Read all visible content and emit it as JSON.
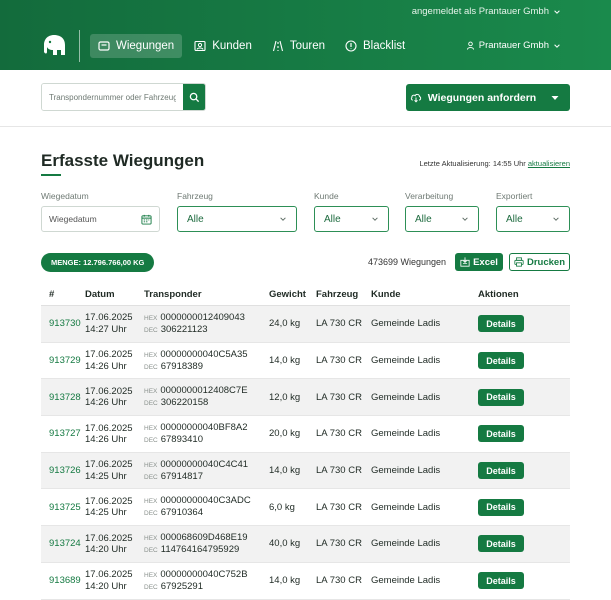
{
  "header": {
    "logged_in_as": "angemeldet als Prantauer Gmbh",
    "user": "Prantauer Gmbh",
    "nav": [
      {
        "label": "Wiegungen",
        "icon": "scale-icon",
        "active": true
      },
      {
        "label": "Kunden",
        "icon": "contact-card-icon",
        "active": false
      },
      {
        "label": "Touren",
        "icon": "road-icon",
        "active": false
      },
      {
        "label": "Blacklist",
        "icon": "block-icon",
        "active": false
      }
    ]
  },
  "toolbar": {
    "search_placeholder": "Transpondernummer oder Fahrzeug s",
    "request_label": "Wiegungen anfordern"
  },
  "main": {
    "title": "Erfasste Wiegungen",
    "last_update_prefix": "Letzte Aktualisierung: 14:55 Uhr",
    "refresh_link": "aktualisieren"
  },
  "filters": {
    "date_label": "Wiegedatum",
    "date_placeholder": "Wiegedatum",
    "vehicle_label": "Fahrzeug",
    "vehicle_value": "Alle",
    "customer_label": "Kunde",
    "customer_value": "Alle",
    "processing_label": "Verarbeitung",
    "processing_value": "Alle",
    "exported_label": "Exportiert",
    "exported_value": "Alle"
  },
  "summary": {
    "menge": "MENGE: 12.796.766,00 KG",
    "count": "473699 Wiegungen",
    "excel_label": "Excel",
    "print_label": "Drucken"
  },
  "table": {
    "headers": [
      "#",
      "Datum",
      "Transponder",
      "Gewicht",
      "Fahrzeug",
      "Kunde",
      "Aktionen"
    ],
    "hex_tag": "HEX",
    "dec_tag": "DEC",
    "details_label": "Details",
    "rows": [
      {
        "id": "913730",
        "date": "17.06.2025",
        "time": "14:27 Uhr",
        "hex": "0000000012409043",
        "dec": "306221123",
        "weight": "24,0 kg",
        "vehicle": "LA 730 CR",
        "customer": "Gemeinde Ladis"
      },
      {
        "id": "913729",
        "date": "17.06.2025",
        "time": "14:26 Uhr",
        "hex": "00000000040C5A35",
        "dec": "67918389",
        "weight": "14,0 kg",
        "vehicle": "LA 730 CR",
        "customer": "Gemeinde Ladis"
      },
      {
        "id": "913728",
        "date": "17.06.2025",
        "time": "14:26 Uhr",
        "hex": "0000000012408C7E",
        "dec": "306220158",
        "weight": "12,0 kg",
        "vehicle": "LA 730 CR",
        "customer": "Gemeinde Ladis"
      },
      {
        "id": "913727",
        "date": "17.06.2025",
        "time": "14:26 Uhr",
        "hex": "00000000040BF8A2",
        "dec": "67893410",
        "weight": "20,0 kg",
        "vehicle": "LA 730 CR",
        "customer": "Gemeinde Ladis"
      },
      {
        "id": "913726",
        "date": "17.06.2025",
        "time": "14:25 Uhr",
        "hex": "00000000040C4C41",
        "dec": "67914817",
        "weight": "14,0 kg",
        "vehicle": "LA 730 CR",
        "customer": "Gemeinde Ladis"
      },
      {
        "id": "913725",
        "date": "17.06.2025",
        "time": "14:25 Uhr",
        "hex": "00000000040C3ADC",
        "dec": "67910364",
        "weight": "6,0 kg",
        "vehicle": "LA 730 CR",
        "customer": "Gemeinde Ladis"
      },
      {
        "id": "913724",
        "date": "17.06.2025",
        "time": "14:20 Uhr",
        "hex": "000068609D468E19",
        "dec": "114764164795929",
        "weight": "40,0 kg",
        "vehicle": "LA 730 CR",
        "customer": "Gemeinde Ladis"
      },
      {
        "id": "913689",
        "date": "17.06.2025",
        "time": "14:20 Uhr",
        "hex": "00000000040C752B",
        "dec": "67925291",
        "weight": "14,0 kg",
        "vehicle": "LA 730 CR",
        "customer": "Gemeinde Ladis"
      }
    ]
  }
}
